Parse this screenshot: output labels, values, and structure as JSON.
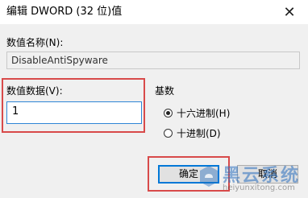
{
  "window": {
    "title": "编辑 DWORD (32 位)值",
    "close_glyph": "✕"
  },
  "value_name": {
    "label": "数值名称(N):",
    "value": "DisableAntiSpyware"
  },
  "value_data": {
    "label": "数值数据(V):",
    "value": "1"
  },
  "base": {
    "label": "基数",
    "options": [
      {
        "label": "十六进制(H)",
        "selected": true
      },
      {
        "label": "十进制(D)",
        "selected": false
      }
    ]
  },
  "buttons": {
    "ok_label": "确定",
    "cancel_label": "取消"
  },
  "watermark": {
    "brand": "黑云系统",
    "url": "heiyunxitong.com"
  },
  "colors": {
    "highlight": "#d84a4a",
    "focus": "#0078d7"
  }
}
